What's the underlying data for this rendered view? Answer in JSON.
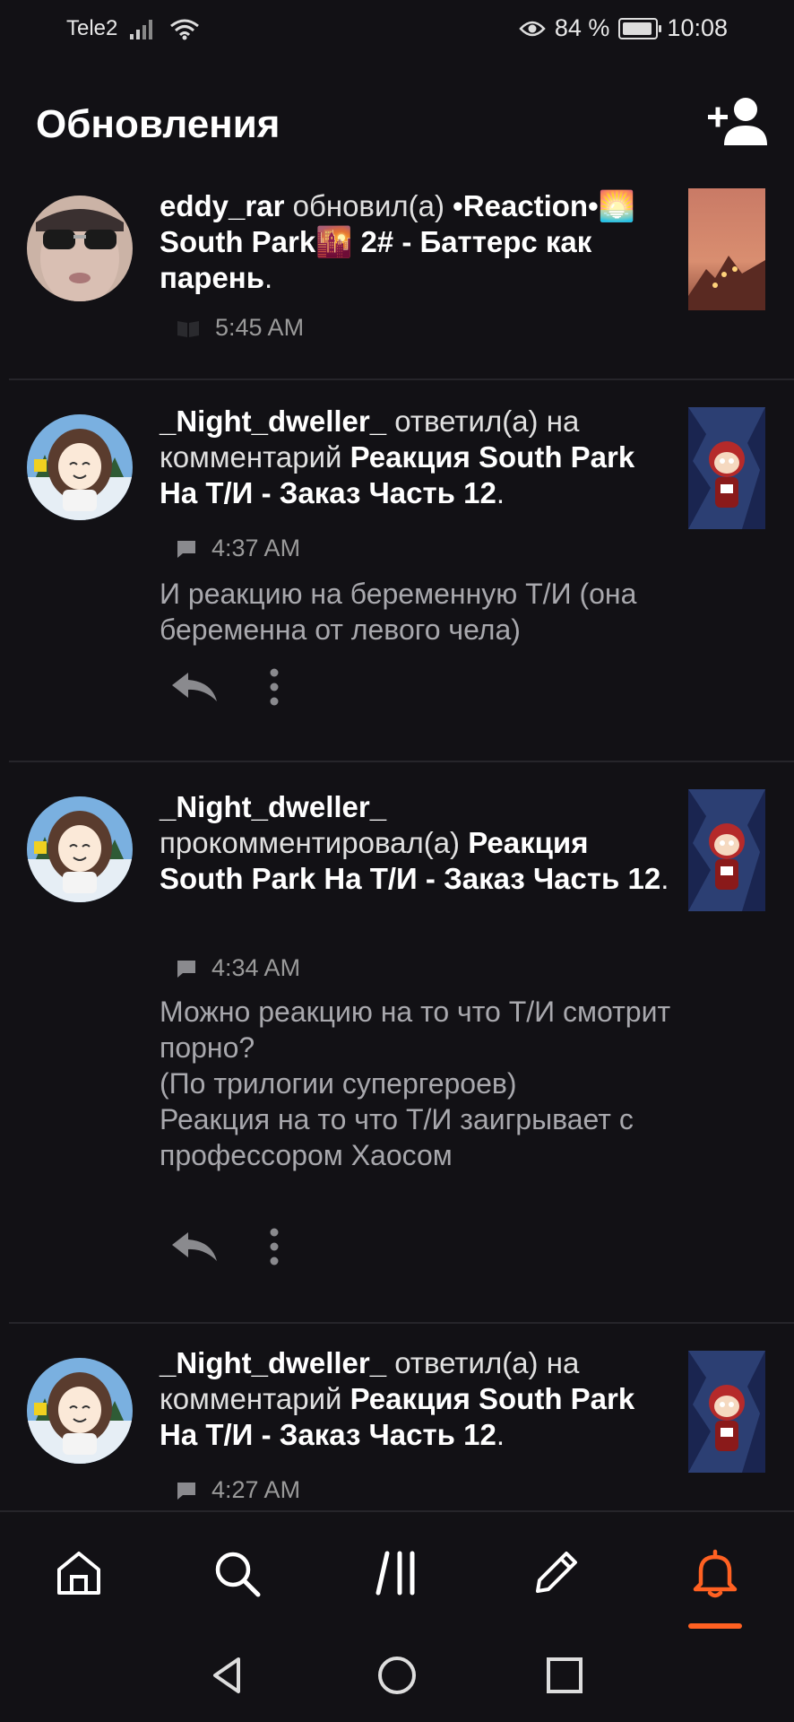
{
  "status_bar": {
    "carrier": "Tele2",
    "battery": "84 %",
    "time": "10:08"
  },
  "header": {
    "title": "Обновления",
    "add_friend_icon": "person-add-icon"
  },
  "feed": [
    {
      "user": "eddy_rar",
      "verb": "обновил(а)",
      "title": "•Reaction•🌅South Park🌇 2# - Баттерс как парень",
      "end": ".",
      "time": "5:45 AM",
      "meta_icon": "book-icon"
    },
    {
      "user": "_Night_dweller_",
      "verb": "ответил(а) на комментарий",
      "title": "Реакция South Park На Т/И - Заказ Часть 12",
      "end": ".",
      "time": "4:37 AM",
      "meta_icon": "comment-icon",
      "comment": "И реакцию на беременную Т/И (она беременна от левого чела)"
    },
    {
      "user": "_Night_dweller_",
      "verb": "прокомментировал(а)",
      "title": "Реакция South Park На Т/И - Заказ Часть 12",
      "end": ".",
      "time": "4:34 AM",
      "meta_icon": "comment-icon",
      "comment": "Можно реакцию на то что Т/И смотрит порно?\n(По трилогии супергероев)\nРеакция на то что Т/И заигрывает с профессором Хаосом"
    },
    {
      "user": "_Night_dweller_",
      "verb": "ответил(а) на комментарий",
      "title": "Реакция South Park На Т/И - Заказ Часть 12",
      "end": ".",
      "time": "4:27 AM",
      "meta_icon": "comment-icon"
    }
  ],
  "bottom_nav": {
    "items": [
      "home-icon",
      "search-icon",
      "library-icon",
      "write-icon",
      "notifications-icon"
    ],
    "active": "notifications-icon",
    "accent": "#ff6122"
  },
  "system_nav": [
    "back-icon",
    "home-circle-icon",
    "recents-icon"
  ]
}
